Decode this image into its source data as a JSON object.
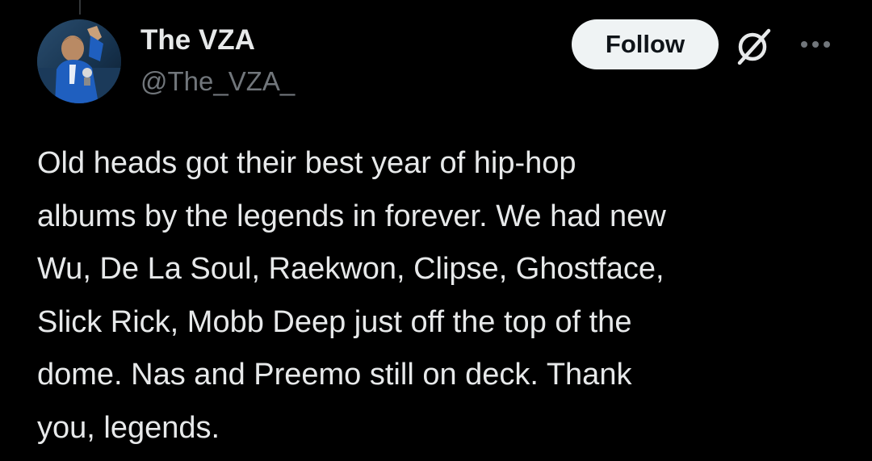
{
  "author": {
    "name": "The VZA",
    "handle": "@The_VZA_",
    "avatar_icon": "user-avatar"
  },
  "actions": {
    "follow_label": "Follow",
    "grok_icon": "grok-icon",
    "more_icon": "more-horizontal-icon"
  },
  "tweet": {
    "lines": [
      "Old heads got their best year of hip-hop",
      "albums by the legends in forever.  We had new",
      "Wu, De La Soul, Raekwon, Clipse, Ghostface,",
      "Slick Rick, Mobb Deep just off the top of the",
      "dome. Nas and Preemo still on deck.  Thank",
      "you, legends."
    ]
  },
  "colors": {
    "background": "#000000",
    "primary_text": "#e7e9ea",
    "secondary_text": "#71767b",
    "follow_bg": "#eff3f4",
    "follow_text": "#0f1419"
  }
}
